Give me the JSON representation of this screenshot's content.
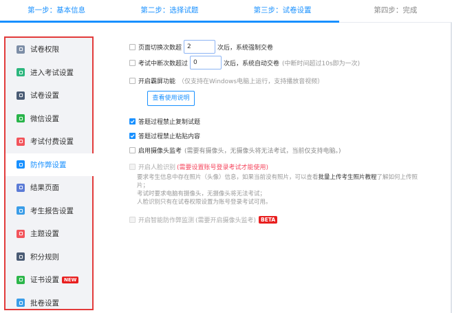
{
  "steps": [
    {
      "label": "第一步：基本信息"
    },
    {
      "label": "第二步：选择试题"
    },
    {
      "label": "第三步：试卷设置"
    },
    {
      "label": "第四步：完成"
    }
  ],
  "sidebar": {
    "items": [
      {
        "label": "试卷权限",
        "icon": "permission-icon",
        "color": "#7c8da6"
      },
      {
        "label": "进入考试设置",
        "icon": "enter-exam-icon",
        "color": "#2cb67d"
      },
      {
        "label": "试卷设置",
        "icon": "paper-settings-icon",
        "color": "#4a5b74"
      },
      {
        "label": "微信设置",
        "icon": "wechat-icon",
        "color": "#29b44a"
      },
      {
        "label": "考试付费设置",
        "icon": "payment-icon",
        "color": "#f2545b"
      },
      {
        "label": "防作弊设置",
        "icon": "anti-cheat-icon",
        "color": "#1890ff"
      },
      {
        "label": "结果页面",
        "icon": "result-page-icon",
        "color": "#5b7bd6"
      },
      {
        "label": "考生报告设置",
        "icon": "report-icon",
        "color": "#3a9de8"
      },
      {
        "label": "主题设置",
        "icon": "theme-icon",
        "color": "#f2545b"
      },
      {
        "label": "积分规则",
        "icon": "points-icon",
        "color": "#4a5b74"
      },
      {
        "label": "证书设置",
        "icon": "certificate-icon",
        "color": "#2cb64a",
        "badge": "NEW"
      },
      {
        "label": "批卷设置",
        "icon": "grading-icon",
        "color": "#3a9de8"
      }
    ],
    "active_index": 5
  },
  "settings": {
    "page_switch": {
      "prefix": "页面切换次数超",
      "value": "2",
      "suffix": "次后，系统强制交卷",
      "checked": false
    },
    "exam_interrupt": {
      "prefix": "考试中断次数超过",
      "value": "0",
      "suffix": "次后，系统自动交卷",
      "hint": "(中断时间超过10s即为一次)",
      "checked": false
    },
    "fullscreen": {
      "label": "开启霸屏功能",
      "hint": "（仅支持在Windows电脑上运行，支持播放音视频）",
      "checked": false
    },
    "manual_button": "查看使用说明",
    "no_copy": {
      "label": "答题过程禁止复制试题",
      "checked": true
    },
    "no_paste": {
      "label": "答题过程禁止粘贴内容",
      "checked": true
    },
    "camera": {
      "label": "启用摄像头监考",
      "hint": "(需要有摄像头，无摄像头将无法考试，当前仅支持电脑。)",
      "checked": false
    },
    "face": {
      "label": "开启人脸识别",
      "warning": "(需要设置账号登录考试才能使用)",
      "checked": false
    },
    "face_desc": {
      "line1_a": "要求考生信息中存在照片（头像）信息，如果当前没有照片，可以查看",
      "line1_link": "批量上传考生照片教程",
      "line1_b": "了解如何上传照片；",
      "line2": "考试时要求电脑有摄像头，无摄像头将无法考试；",
      "line3": "人脸识别只有在试卷权限设置为账号登录考试可用。"
    },
    "smart": {
      "label": "开启智能防作弊监测",
      "hint": "(需要开启摄像头监考)",
      "badge": "BETA",
      "checked": false
    }
  }
}
